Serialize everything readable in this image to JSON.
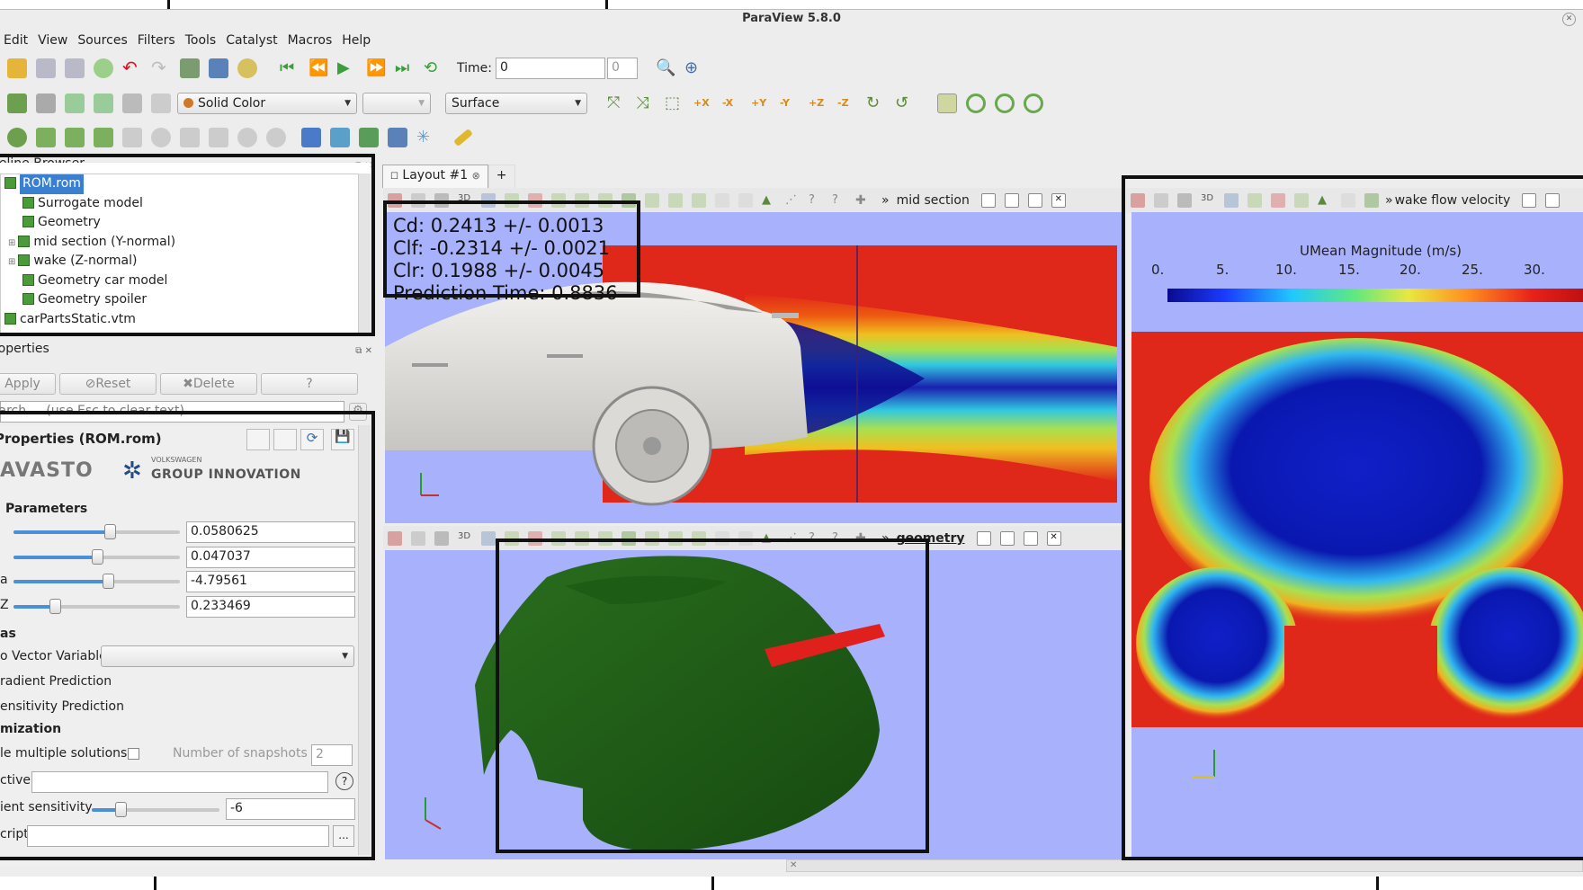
{
  "window": {
    "title": "ParaView 5.8.0"
  },
  "menu": [
    "Edit",
    "View",
    "Sources",
    "Filters",
    "Tools",
    "Catalyst",
    "Macros",
    "Help"
  ],
  "toolbar": {
    "time_label": "Time:",
    "time_value": "0",
    "time_step": "0",
    "color_by": "Solid Color",
    "representation": "Surface"
  },
  "pipeline": {
    "title": "Pipeline Browser",
    "items": [
      {
        "label": "ROM.rom",
        "selected": true
      },
      {
        "label": "Surrogate model"
      },
      {
        "label": "Geometry"
      },
      {
        "label": "mid section (Y-normal)"
      },
      {
        "label": "wake (Z-normal)"
      },
      {
        "label": "Geometry car model"
      },
      {
        "label": "Geometry spoiler"
      },
      {
        "label": "carPartsStatic.vtm"
      }
    ]
  },
  "properties": {
    "title": "Properties",
    "apply": "Apply",
    "reset": "Reset",
    "delete": "Delete",
    "help": "?",
    "search_placeholder": "Search ... (use Esc to clear text)",
    "section_title": "Properties (ROM.rom)",
    "logo_left": "AVASTO",
    "logo_right_small": "VOLKSWAGEN",
    "logo_right": "GROUP INNOVATION",
    "parameters_heading": "Parameters",
    "params": [
      {
        "label": "",
        "value": "0.0580625",
        "level": 0.58
      },
      {
        "label": "",
        "value": "0.047037",
        "level": 0.5
      },
      {
        "label": "a",
        "value": "-4.79561",
        "level": 0.57
      },
      {
        "label": "Z",
        "value": "0.233469",
        "level": 0.25
      }
    ],
    "options_heading": "as",
    "vector_variable_label": "o Vector Variable",
    "gradient_prediction": "radient Prediction",
    "sensitivity_prediction": "ensitivity Prediction",
    "optimization_heading": "mization",
    "multiple_solutions": "le multiple solutions",
    "snapshots_label": "Number of snapshots",
    "snapshots_value": "2",
    "objective_label": "ctive",
    "gradient_sensitivity_label": "ient sensitivity",
    "gradient_sensitivity_value": "-6",
    "script_label": "cript",
    "script_button": "..."
  },
  "layout": {
    "tab": "Layout #1",
    "add": "+"
  },
  "views": {
    "mid": {
      "title": "mid section",
      "cd": "Cd: 0.2413 +/- 0.0013",
      "clf": "Clf: -0.2314 +/- 0.0021",
      "clr": "Clr: 0.1988 +/- 0.0045",
      "pred_time": "Prediction Time: 0.8836"
    },
    "geometry": {
      "title": "geometry"
    },
    "wake": {
      "title": "wake flow velocity",
      "legend_title": "UMean Magnitude (m/s)",
      "ticks": [
        "0.",
        "5.",
        "10.",
        "15.",
        "20.",
        "25.",
        "30."
      ]
    }
  },
  "colors": {
    "view_bg": "#a8b1fb",
    "flow_red": "#e0281a",
    "car_green": "#1e5a16",
    "spoiler_red": "#e0201c"
  }
}
